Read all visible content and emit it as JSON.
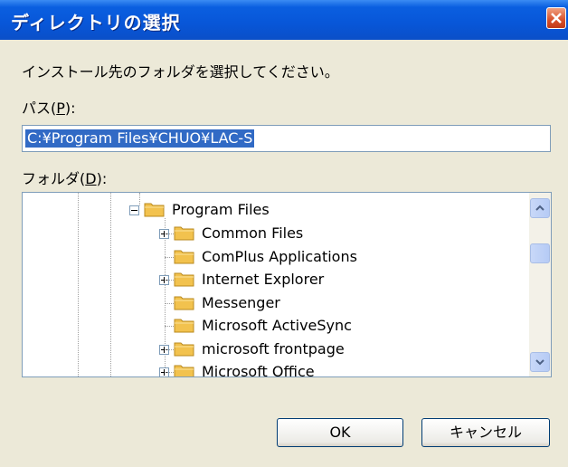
{
  "window": {
    "title": "ディレクトリの選択"
  },
  "instruction": "インストール先のフォルダを選択してください。",
  "path": {
    "label_prefix": "パス(",
    "label_key": "P",
    "label_suffix": "):",
    "value": "C:¥Program Files¥CHUO¥LAC-S"
  },
  "folder": {
    "label_prefix": "フォルダ(",
    "label_key": "D",
    "label_suffix": "):"
  },
  "tree": {
    "root": "Program Files",
    "items": [
      {
        "label": "Common Files",
        "expander": "plus"
      },
      {
        "label": "ComPlus Applications",
        "expander": "none"
      },
      {
        "label": "Internet Explorer",
        "expander": "plus"
      },
      {
        "label": "Messenger",
        "expander": "none"
      },
      {
        "label": "Microsoft ActiveSync",
        "expander": "none"
      },
      {
        "label": "microsoft frontpage",
        "expander": "plus"
      },
      {
        "label": "Microsoft Office",
        "expander": "plus"
      }
    ]
  },
  "buttons": {
    "ok": "OK",
    "cancel": "キャンセル"
  },
  "colors": {
    "titlebar": "#0856d8",
    "selection": "#316ac5",
    "folder": "#f2c24e"
  }
}
